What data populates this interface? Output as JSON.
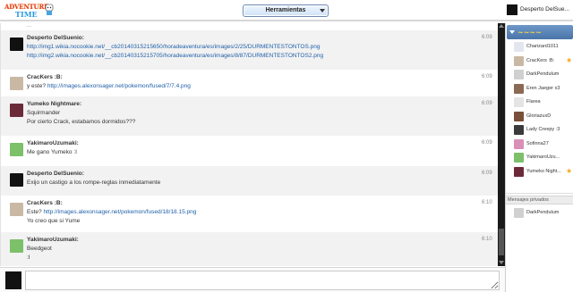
{
  "header": {
    "logo_text_top": "ADVENTURE",
    "logo_text_bottom": "TIME",
    "tools_label": "Herramientas",
    "current_user": "Desperto DelSue..."
  },
  "chat": {
    "top_fragment": "...",
    "messages": [
      {
        "user": "Desperto DelSuenio:",
        "time": "6:09",
        "avatar_color": "#111111",
        "lines": [
          {
            "text": "http://img1.wikia.nocookie.net/__cb20140315215650/horadeaventura/es/images/2/25/DURMENTESTONTOS.png",
            "link": true
          },
          {
            "text": "http://img2.wikia.nocookie.net/__cb20140315215705/horadeaventura/es/images/8/87/DURMENTESTONTOS2.png",
            "link": true
          }
        ]
      },
      {
        "user": "CracKers :B:",
        "time": "6:09",
        "avatar_color": "#c9b9a4",
        "lines": [
          {
            "prefix": "y este? ",
            "text": "http://images.alexonsager.net/pokemon/fused/7/7.4.png",
            "link": true
          }
        ]
      },
      {
        "user": "Yumeko Nightmare:",
        "time": "6:09",
        "avatar_color": "#6b2a3a",
        "lines": [
          {
            "text": "Squirmander",
            "link": false
          },
          {
            "text": "Por cierto Crack, estabamos dormidos???",
            "link": false
          }
        ]
      },
      {
        "user": "YakimaroUzumaki:",
        "time": "6:09",
        "avatar_color": "#7cc06a",
        "lines": [
          {
            "text": "Me gano Yumeko :I",
            "link": false
          }
        ]
      },
      {
        "user": "Desperto DelSuenio:",
        "time": "6:09",
        "avatar_color": "#111111",
        "lines": [
          {
            "text": "Exijo un castigo a los rompe-reglas inmediatamente",
            "link": false
          }
        ]
      },
      {
        "user": "CracKers :B:",
        "time": "6:10",
        "avatar_color": "#c9b9a4",
        "lines": [
          {
            "prefix": "Este? ",
            "text": "http://images.alexonsager.net/pokemon/fused/18/18.15.png",
            "link": true
          },
          {
            "text": "Yo creo que si Yume",
            "link": false
          }
        ]
      },
      {
        "user": "YakimaroUzumaki:",
        "time": "6:10",
        "avatar_color": "#7cc06a",
        "lines": [
          {
            "text": "Beedgeot",
            "link": false
          },
          {
            "text": ":I",
            "link": false
          }
        ]
      }
    ]
  },
  "sidebar": {
    "users": [
      {
        "name": "Charizard1011",
        "avatar_color": "#e3e6ef",
        "star": false
      },
      {
        "name": "CracKers :B:",
        "avatar_color": "#c9b9a4",
        "star": true
      },
      {
        "name": "DarkPendulum",
        "avatar_color": "#d0d0d0",
        "star": false
      },
      {
        "name": "Eren Jaeger x3",
        "avatar_color": "#8a6a55",
        "star": false
      },
      {
        "name": "Flarea",
        "avatar_color": "#e4e4e4",
        "star": false
      },
      {
        "name": "GloriazuxD",
        "avatar_color": "#7a4f3a",
        "star": false
      },
      {
        "name": "Lady Creepy :3",
        "avatar_color": "#3b3b3b",
        "star": false
      },
      {
        "name": "Sofinna27",
        "avatar_color": "#d98fb6",
        "star": false
      },
      {
        "name": "YakimaroUzu...",
        "avatar_color": "#7cc06a",
        "star": false
      },
      {
        "name": "Yumeko Night...",
        "avatar_color": "#6b2a3a",
        "star": true
      }
    ],
    "pm_header": "Mensajes privados",
    "pm_users": [
      {
        "name": "DarkPendulum",
        "avatar_color": "#d0d0d0"
      }
    ]
  },
  "composer": {
    "value": ""
  },
  "colors": {
    "accent": "#4a74a8",
    "link": "#1f5fa8",
    "star": "#f5a623"
  }
}
